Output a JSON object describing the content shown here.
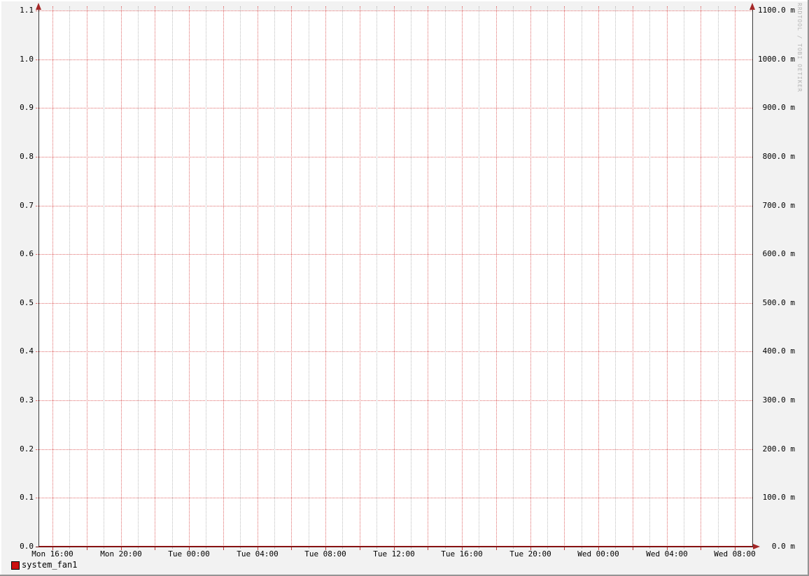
{
  "watermark": "RRDTOOL / TOBI OETIKER",
  "legend": {
    "label": "system_fan1",
    "swatch_color": "#cc1111"
  },
  "colors": {
    "back": "#f2f2f2",
    "canvas": "#ffffff",
    "shade": "#949494",
    "major_grid": "#e06a6a",
    "minor_grid": "#bdbdbd",
    "tick": "#c03c3c",
    "axis": "#3a3a3a",
    "x_axis": "#6e1010",
    "series": "#9c1414",
    "arrow": "#a52828",
    "text": "#000000",
    "watermark": "#b5b5b5",
    "legend": "#cc1111"
  },
  "chart_data": {
    "type": "line",
    "title": "",
    "xlabel": "",
    "ylabel": "",
    "x_tick_labels": [
      "Mon 16:00",
      "Mon 20:00",
      "Tue 00:00",
      "Tue 04:00",
      "Tue 08:00",
      "Tue 12:00",
      "Tue 16:00",
      "Tue 20:00",
      "Wed 00:00",
      "Wed 04:00",
      "Wed 08:00"
    ],
    "x_label_every_hours": 4,
    "x_major_grid_hours": 2,
    "x_minor_grid_hours": 1,
    "x_span_hours": 40,
    "y_ticks_left": [
      "0.0",
      "0.1",
      "0.2",
      "0.3",
      "0.4",
      "0.5",
      "0.6",
      "0.7",
      "0.8",
      "0.9",
      "1.0",
      "1.1"
    ],
    "y_ticks_right": [
      "0.0 m",
      "100.0 m",
      "200.0 m",
      "300.0 m",
      "400.0 m",
      "500.0 m",
      "600.0 m",
      "700.0 m",
      "800.0 m",
      "900.0 m",
      "1000.0 m",
      "1100.0 m"
    ],
    "ylim_left": [
      0.0,
      1.1
    ],
    "ylim_right_milli": [
      0.0,
      1100.0
    ],
    "grid": true,
    "legend_position": "bottom-left",
    "series": [
      {
        "name": "system_fan1",
        "color": "#cc1111",
        "values": [
          0,
          0,
          0,
          0,
          0,
          0,
          0,
          0,
          0,
          0,
          0
        ]
      }
    ]
  }
}
